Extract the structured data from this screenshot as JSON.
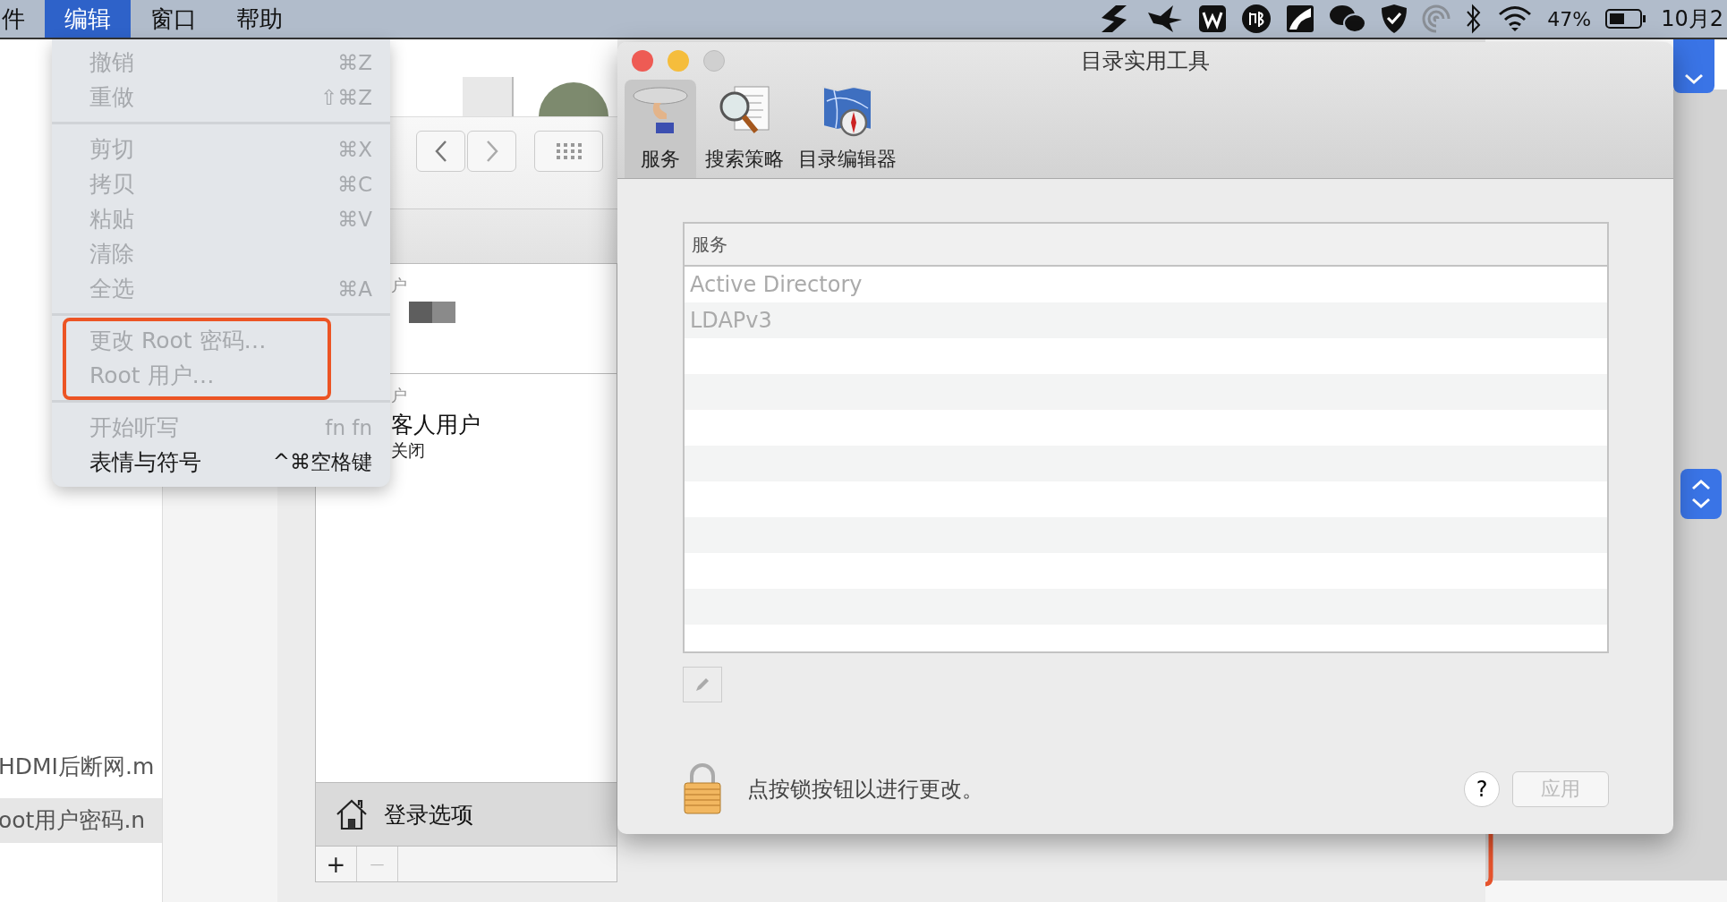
{
  "menu_bar": {
    "items": [
      {
        "label": "件",
        "selected": false
      },
      {
        "label": "编辑",
        "selected": true
      },
      {
        "label": "窗口",
        "selected": false
      },
      {
        "label": "帮助",
        "selected": false
      }
    ],
    "battery": "47%",
    "clock": "10月2"
  },
  "edit_menu": {
    "sections": [
      {
        "annotated": false,
        "items": [
          {
            "label": "撤销",
            "shortcut": "⌘Z",
            "disabled": true
          },
          {
            "label": "重做",
            "shortcut": "⇧⌘Z",
            "disabled": true
          }
        ]
      },
      {
        "annotated": false,
        "items": [
          {
            "label": "剪切",
            "shortcut": "⌘X",
            "disabled": true
          },
          {
            "label": "拷贝",
            "shortcut": "⌘C",
            "disabled": true
          },
          {
            "label": "粘贴",
            "shortcut": "⌘V",
            "disabled": true
          },
          {
            "label": "清除",
            "disabled": true
          },
          {
            "label": "全选",
            "shortcut": "⌘A",
            "disabled": true
          }
        ]
      },
      {
        "annotated": true,
        "items": [
          {
            "label": "更改 Root 密码…",
            "disabled": true
          },
          {
            "label": "Root 用户…",
            "disabled": true
          }
        ]
      },
      {
        "annotated": false,
        "items": [
          {
            "label": "开始听写",
            "shortcut": "fn fn",
            "disabled": true
          },
          {
            "label": "表情与符号",
            "shortcut": "^⌘空格键",
            "disabled": false
          }
        ]
      }
    ]
  },
  "finder_files": [
    {
      "name": "HDMI后断网.m",
      "selected": false
    },
    {
      "name": "oot用户密码.n",
      "selected": true
    }
  ],
  "users_window": {
    "groups": [
      {
        "header": "户",
        "redacted": true
      },
      {
        "header": "户",
        "name": "客人用户",
        "status": "关闭",
        "redacted": false
      }
    ],
    "login_options": "登录选项",
    "add_button": {
      "label": "+",
      "disabled": false
    },
    "remove_button": {
      "label": "—",
      "disabled": true
    }
  },
  "dialog": {
    "title": "目录实用工具",
    "tabs": [
      {
        "label": "服务",
        "selected": true
      },
      {
        "label": "搜索策略",
        "selected": false
      },
      {
        "label": "目录编辑器",
        "selected": false
      }
    ],
    "table": {
      "column": "服务",
      "rows": [
        {
          "name": "Active Directory",
          "disabled": true
        },
        {
          "name": "LDAPv3",
          "disabled": true
        }
      ]
    },
    "lock_message": "点按锁按钮以进行更改。",
    "help": "?",
    "apply": {
      "label": "应用",
      "disabled": true
    }
  }
}
